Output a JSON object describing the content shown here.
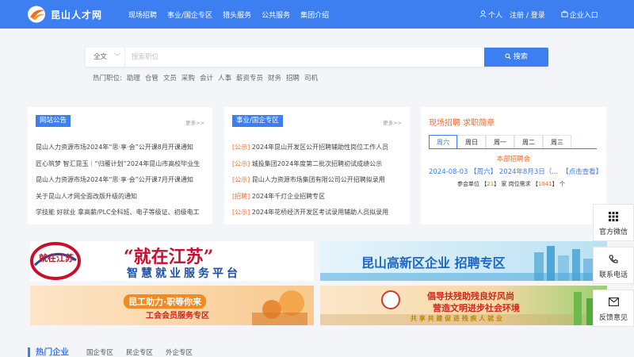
{
  "header": {
    "logo_text": "昆山人才网",
    "nav": [
      "现场招聘",
      "事业/国企专区",
      "猎头服务",
      "公共服务",
      "集团介绍"
    ],
    "personal": "个人",
    "register_login": "注册 / 登录",
    "enterprise": "企业入口",
    "brand_color": "#3d7ef0"
  },
  "search": {
    "type": "全文",
    "placeholder": "搜索职位",
    "button": "搜索",
    "hot_label": "热门职位:",
    "hot_jobs": [
      "助理",
      "仓管",
      "文员",
      "采购",
      "会计",
      "人事",
      "薪资专员",
      "财务",
      "招聘",
      "司机"
    ]
  },
  "news": {
    "title": "网站公告",
    "more": "更多>>",
    "items": [
      "昆山人力资源市场2024年“思·享·会”公开课8月开课通知",
      "匠心筑梦 智汇昆玉｜“归雁计划”2024年昆山市高校毕业生",
      "昆山人力资源市场2024年“思·享·会”公开课7月开课通知",
      "关于昆山人才网全面改版升级的通知",
      "学技能 好就业 拿高薪/PLC全科班、电子等级证、初级电工"
    ]
  },
  "public": {
    "title": "事业/国企专区",
    "more": "更多>>",
    "items": [
      {
        "tag": "[公示]",
        "text": "2024年昆山开发区公开招聘辅助性岗位工作人员"
      },
      {
        "tag": "[公示]",
        "text": "城投集团2024年度第二批次招聘初试成绩公示"
      },
      {
        "tag": "[公示]",
        "text": "昆山人力资源市场集团有限公司公开招聘拟录用"
      },
      {
        "tag": "[招聘]",
        "text": "2024年千灯企业招聘专区"
      },
      {
        "tag": "[公示]",
        "text": "2024年花桥经济开发区考试录用辅助人员拟录用"
      }
    ]
  },
  "fair": {
    "title": "现场招聘 求职简章",
    "days": [
      "周六",
      "周日",
      "周一",
      "周二",
      "周三"
    ],
    "active_day": "周六",
    "venue": "本部招聘会",
    "date_line": "2024-08-03 【周六】 2024年8月3日（...",
    "view": "【点击查看】",
    "stats_prefix": "参会单位 【",
    "company_count": "21",
    "stats_mid": "】 家 岗位需求 【",
    "job_count": "1041",
    "stats_suffix": "】 个"
  },
  "banners": {
    "b1_main": "“就在江苏”",
    "b1_logo": "就在江苏",
    "b1_sub": "智慧就业服务平台",
    "b2_title": "昆山高新区企业 招聘专区",
    "b3_title": "昆工助力·职等你来",
    "b3_sub": "工会会员服务专区",
    "b4_line1": "倡导扶残助残良好风尚",
    "b4_line2": "营造文明进步社会环境",
    "b4_sub": "共 享 共 建   促 进 残 疾 人 就 业"
  },
  "sidebar": {
    "wechat": "官方微信",
    "phone": "联系电话",
    "feedback": "反馈意见"
  },
  "hot_companies": {
    "title": "热门企业",
    "tabs": [
      "国企专区",
      "民企专区",
      "外企专区"
    ]
  },
  "colors": {
    "accent": "#3d7ef0",
    "orange": "#f36b2b"
  }
}
